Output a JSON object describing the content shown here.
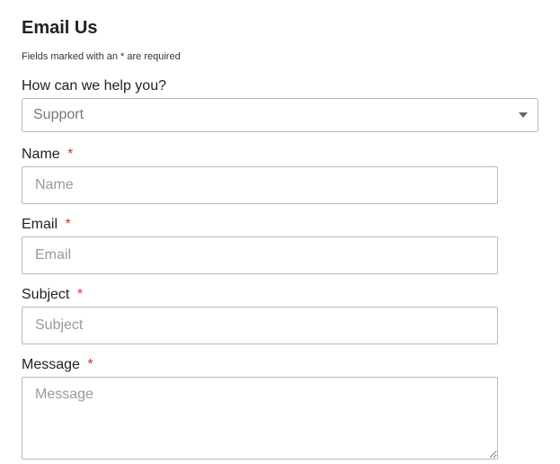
{
  "title": "Email Us",
  "required_note": "Fields marked with an * are required",
  "help": {
    "label": "How can we help you?",
    "selected": "Support"
  },
  "name": {
    "label": "Name",
    "star": "*",
    "placeholder": "Name"
  },
  "email": {
    "label": "Email",
    "star": "*",
    "placeholder": "Email"
  },
  "subject": {
    "label": "Subject",
    "star": "*",
    "placeholder": "Subject"
  },
  "message": {
    "label": "Message",
    "star": "*",
    "placeholder": "Message"
  }
}
